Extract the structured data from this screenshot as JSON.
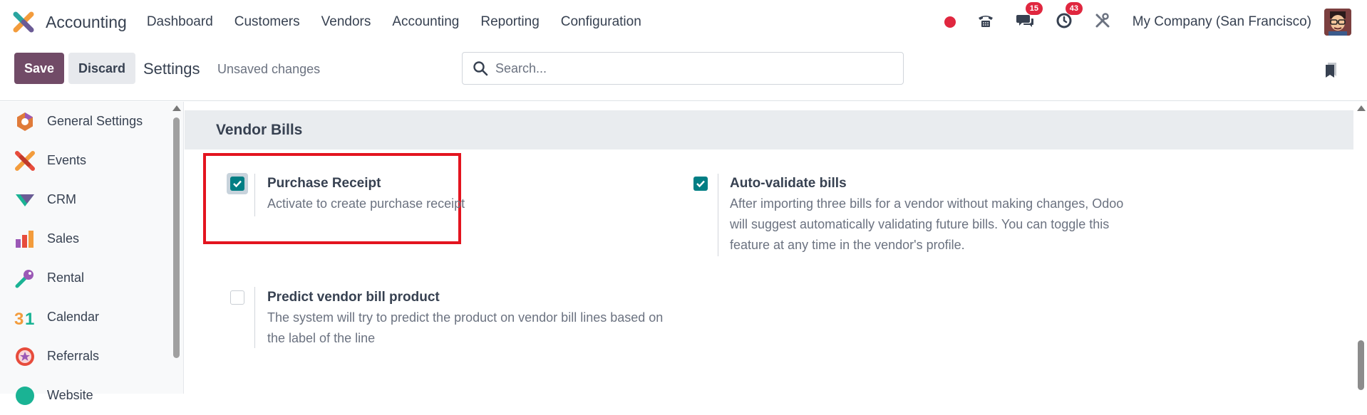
{
  "navbar": {
    "app_name": "Accounting",
    "menu": [
      "Dashboard",
      "Customers",
      "Vendors",
      "Accounting",
      "Reporting",
      "Configuration"
    ],
    "messages_count": "15",
    "activities_count": "43",
    "company": "My Company (San Francisco)"
  },
  "control_panel": {
    "save_label": "Save",
    "discard_label": "Discard",
    "title": "Settings",
    "status": "Unsaved changes",
    "search_placeholder": "Search..."
  },
  "sidebar": {
    "items": [
      {
        "label": "General Settings",
        "icon": "general-settings-icon"
      },
      {
        "label": "Events",
        "icon": "events-icon"
      },
      {
        "label": "CRM",
        "icon": "crm-icon"
      },
      {
        "label": "Sales",
        "icon": "sales-icon"
      },
      {
        "label": "Rental",
        "icon": "rental-icon"
      },
      {
        "label": "Calendar",
        "icon": "calendar-icon"
      },
      {
        "label": "Referrals",
        "icon": "referrals-icon"
      },
      {
        "label": "Website",
        "icon": "website-icon"
      }
    ]
  },
  "section": {
    "title": "Vendor Bills",
    "settings": [
      {
        "title": "Purchase Receipt",
        "description": "Activate to create purchase receipt",
        "checked": true
      },
      {
        "title": "Auto-validate bills",
        "description": "After importing three bills for a vendor without making changes, Odoo will suggest automatically validating future bills. You can toggle this feature at any time in the vendor's profile.",
        "checked": true
      },
      {
        "title": "Predict vendor bill product",
        "description": "The system will try to predict the product on vendor bill lines based on the label of the line",
        "checked": false
      }
    ]
  },
  "colors": {
    "brand_primary": "#714B67",
    "checkbox_active": "#017e84",
    "highlight": "#e3141f",
    "badge": "#e0273f"
  }
}
